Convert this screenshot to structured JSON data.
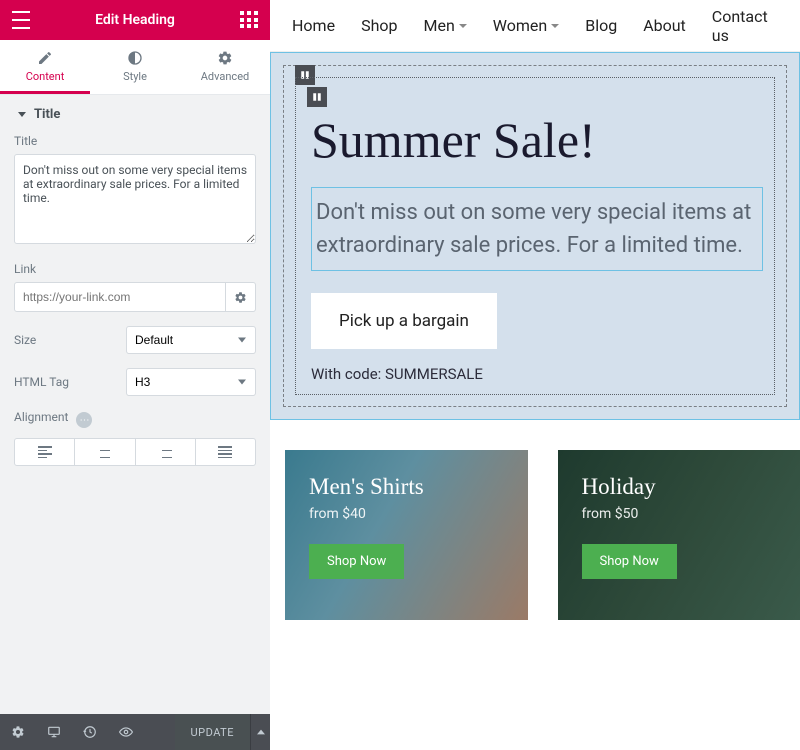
{
  "sidebar": {
    "header_title": "Edit Heading",
    "tabs": {
      "content": "Content",
      "style": "Style",
      "advanced": "Advanced"
    },
    "section_label": "Title",
    "title_field_label": "Title",
    "title_value": "Don't miss out on some very special items at extraordinary sale prices. For a limited time.",
    "link_label": "Link",
    "link_placeholder": "https://your-link.com",
    "size_label": "Size",
    "size_value": "Default",
    "htmltag_label": "HTML Tag",
    "htmltag_value": "H3",
    "alignment_label": "Alignment",
    "update_label": "UPDATE"
  },
  "nav": {
    "items": [
      "Home",
      "Shop",
      "Men",
      "Women",
      "Blog",
      "About",
      "Contact us"
    ]
  },
  "hero": {
    "headline": "Summer Sale!",
    "subhead": "Don't miss out on some very special items at extraordinary sale prices. For a limited time.",
    "cta": "Pick up a bargain",
    "promo": "With code: SUMMERSALE"
  },
  "cards": [
    {
      "title": "Men's Shirts",
      "price": "from $40",
      "cta": "Shop Now"
    },
    {
      "title": "Holiday",
      "price": "from $50",
      "cta": "Shop Now"
    }
  ]
}
